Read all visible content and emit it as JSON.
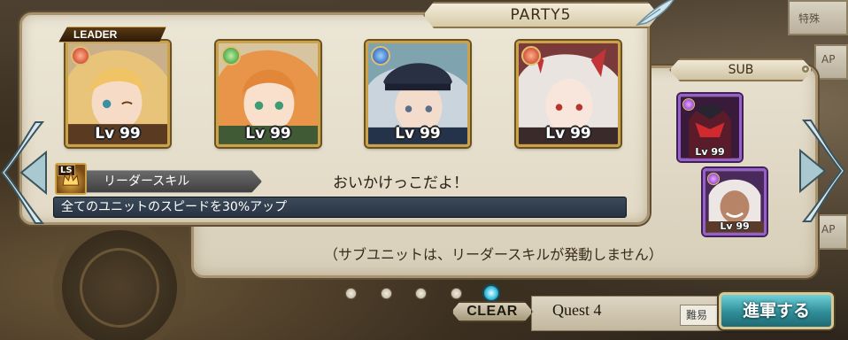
{
  "party": {
    "title": "PARTY5"
  },
  "leader_tag": "LEADER",
  "main_units": [
    {
      "level": "Lv 99",
      "element": "fire",
      "element_color": "#e0421e"
    },
    {
      "level": "Lv 99",
      "element": "wind",
      "element_color": "#3aa03a"
    },
    {
      "level": "Lv 99",
      "element": "water",
      "element_color": "#2c6fd0"
    },
    {
      "level": "Lv 99",
      "element": "fire",
      "element_color": "#e0421e"
    }
  ],
  "sub": {
    "title": "SUB",
    "units": [
      {
        "level": "Lv 99",
        "element": "dark"
      },
      {
        "level": "Lv 99",
        "element": "dark"
      }
    ]
  },
  "leader_skill": {
    "badge": "LS",
    "label": "リーダースキル",
    "name": "おいかけっこだよ！",
    "description": "全てのユニットのスピードを30%アップ"
  },
  "sub_note": "（サブユニットは、リーダースキルが発動しません）",
  "pager": {
    "count": 5,
    "active_index": 4
  },
  "bottom": {
    "clear_badge": "CLEAR",
    "quest_label": "Quest 4",
    "difficulty_chip": "難易",
    "march_button": "進軍する"
  },
  "background": {
    "tag_top": "特殊",
    "tag_a": "AP",
    "tag_b": "AP"
  },
  "colors": {
    "panel": "#ece6d6",
    "frame_gold": "#c9a24a",
    "sub_frame_purple": "#9560c8",
    "march_teal": "#2f8d98",
    "skill_bar": "#283442"
  }
}
